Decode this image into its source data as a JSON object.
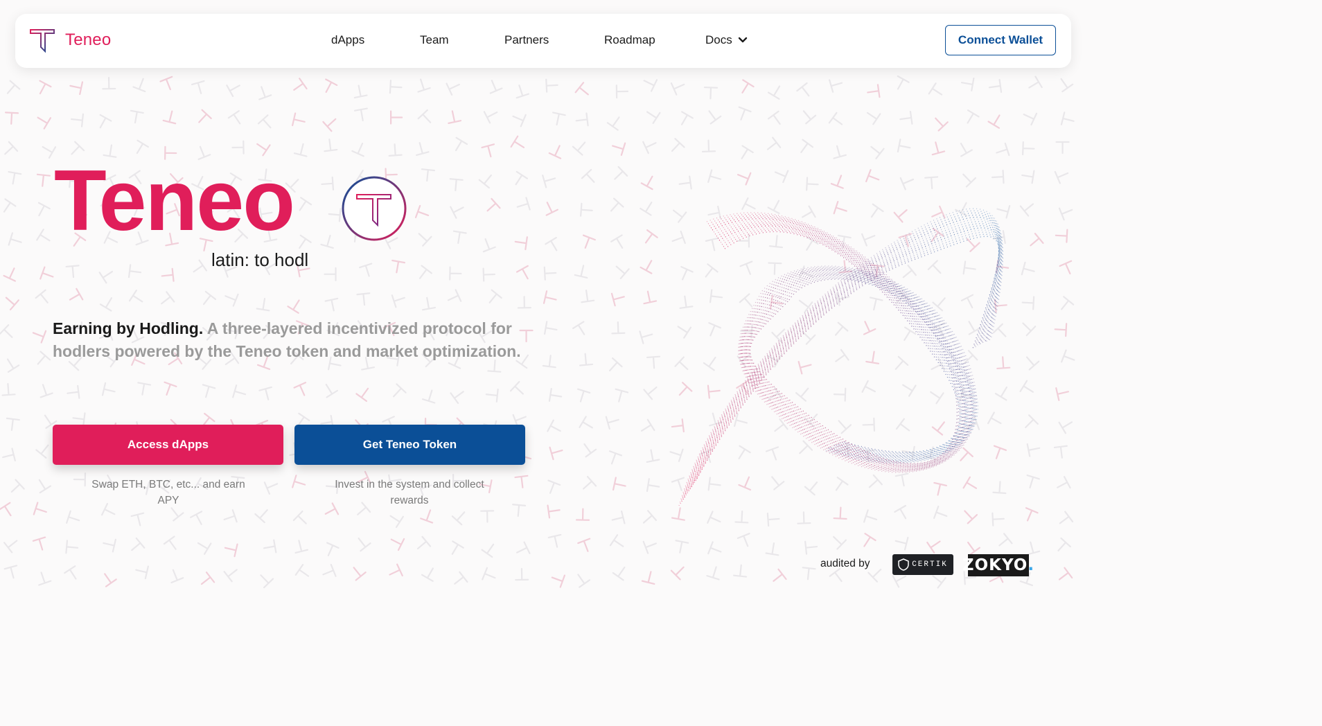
{
  "nav": {
    "brand": "Teneo",
    "links": [
      "dApps",
      "Team",
      "Partners",
      "Roadmap",
      "Docs"
    ],
    "connect_label": "Connect Wallet"
  },
  "hero": {
    "title": "Teneo",
    "subtitle": "latin: to hodl",
    "tagline_strong": "Earning by Hodling.",
    "tagline_rest": "A three-layered incentivized protocol for hodlers powered by the Teneo token and market optimization."
  },
  "actions": {
    "access_label": "Access dApps",
    "access_caption": "Swap ETH, BTC, etc... and earn APY",
    "token_label": "Get Teneo Token",
    "token_caption": "Invest in the system and collect rewards"
  },
  "audit": {
    "label": "audited by",
    "certik": "CERTIK",
    "zokyo": "ZOKYO",
    "zokyo_dot": "."
  },
  "colors": {
    "brand_pink": "#e01e5a",
    "brand_blue": "#0b4f97"
  },
  "icons": [
    "teneo-logo-icon",
    "chevron-down-icon",
    "certik-shield-icon"
  ]
}
